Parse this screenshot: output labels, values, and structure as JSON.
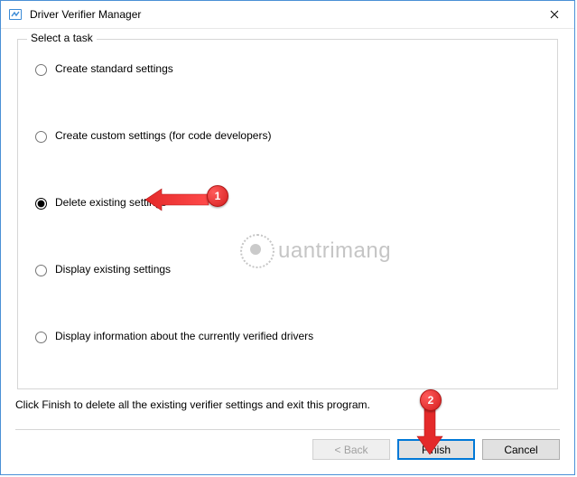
{
  "window": {
    "title": "Driver Verifier Manager"
  },
  "group": {
    "legend": "Select a task"
  },
  "options": {
    "create_standard": "Create standard settings",
    "create_custom": "Create custom settings (for code developers)",
    "delete_existing": "Delete existing settings",
    "display_existing": "Display existing settings",
    "display_info": "Display information about the currently verified drivers"
  },
  "selected_option": "delete_existing",
  "instruction": "Click Finish to delete all the existing verifier settings and exit this program.",
  "buttons": {
    "back": "< Back",
    "finish": "Finish",
    "cancel": "Cancel"
  },
  "annotations": {
    "badge1": "1",
    "badge2": "2"
  },
  "watermark": {
    "text": "uantrimang"
  }
}
